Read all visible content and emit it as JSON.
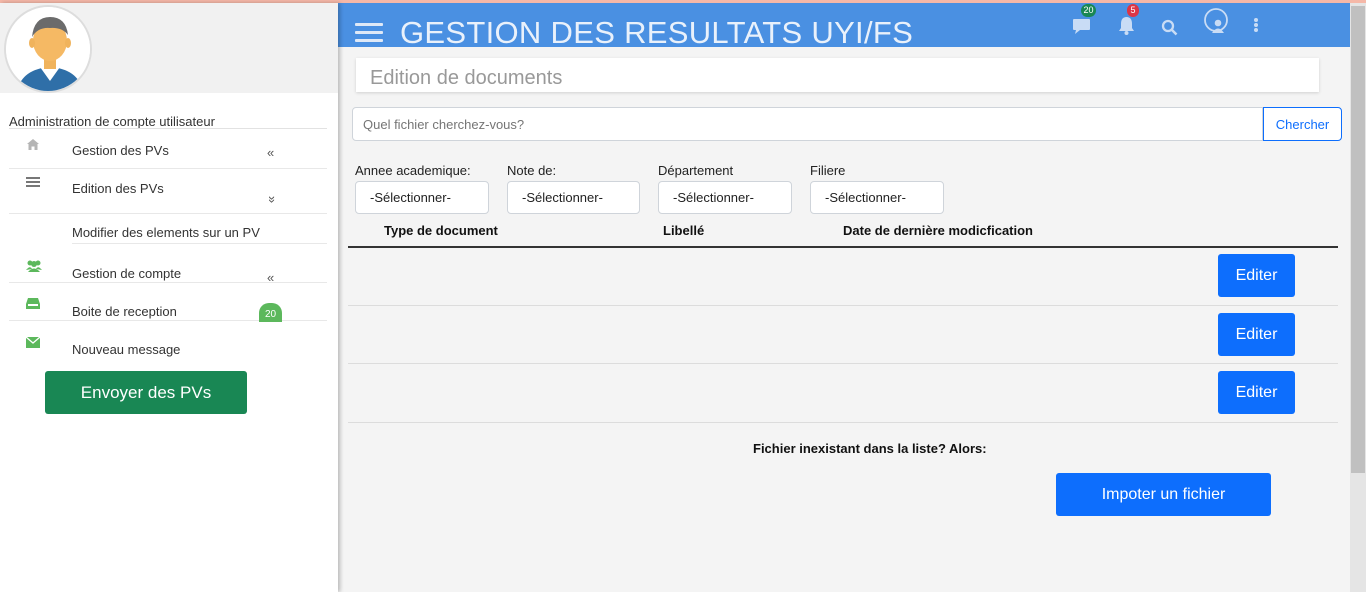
{
  "header": {
    "title": "GESTION DES RESULTATS UYI/FS",
    "messages_badge": "20",
    "notifications_badge": "5",
    "accent_color": "#4a90e2"
  },
  "sidebar": {
    "section_title": "Administration de compte utilisateur",
    "items": [
      {
        "label": "Gestion des PVs",
        "icon": "home-icon",
        "arrow": "«"
      },
      {
        "label": "Edition des PVs",
        "icon": "list-icon",
        "arrow": "»"
      },
      {
        "label": "Gestion de compte",
        "icon": "users-icon",
        "arrow": "«"
      },
      {
        "label": "Boite de reception",
        "icon": "inbox-icon",
        "badge": "20"
      },
      {
        "label": "Nouveau message",
        "icon": "envelope-icon"
      }
    ],
    "submenu_item": "Modifier des elements sur un PV",
    "send_button": "Envoyer des PVs",
    "send_button_color": "#198754"
  },
  "main": {
    "page_title": "Edition de documents",
    "search": {
      "placeholder": "Quel fichier cherchez-vous?",
      "button": "Chercher"
    },
    "filters": [
      {
        "label": "Annee academique:",
        "value": "-Sélectionner-"
      },
      {
        "label": "Note de:",
        "value": "-Sélectionner-"
      },
      {
        "label": "Département",
        "value": "-Sélectionner-"
      },
      {
        "label": "Filiere",
        "value": "-Sélectionner-"
      }
    ],
    "table": {
      "columns": [
        "Type de document",
        "Libellé",
        "Date de dernière modicfication"
      ],
      "rows": [
        {
          "action": "Editer"
        },
        {
          "action": "Editer"
        },
        {
          "action": "Editer"
        }
      ]
    },
    "missing_text": "Fichier inexistant dans la liste? Alors:",
    "import_button": "Impoter un fichier",
    "button_color": "#0d6efd"
  }
}
